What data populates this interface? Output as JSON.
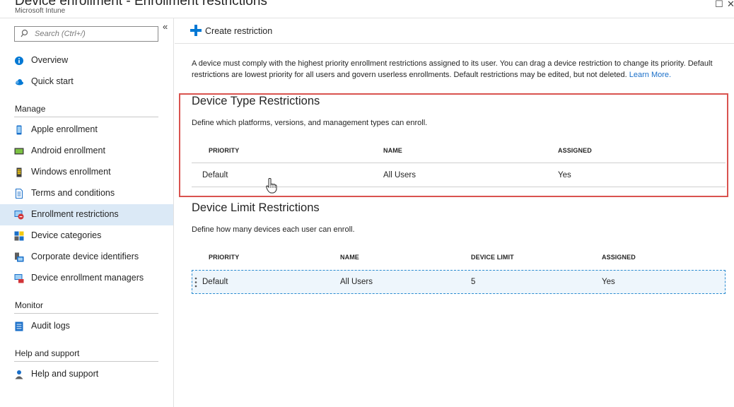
{
  "header": {
    "title": "Device enrollment - Enrollment restrictions",
    "subtitle": "Microsoft Intune"
  },
  "sidebar": {
    "search_placeholder": "Search (Ctrl+/)",
    "collapse_glyph": "«",
    "items_top": [
      {
        "label": "Overview",
        "icon": "info-icon"
      },
      {
        "label": "Quick start",
        "icon": "cloud-icon"
      }
    ],
    "manage_header": "Manage",
    "manage_items": [
      {
        "label": "Apple enrollment",
        "icon": "phone-icon"
      },
      {
        "label": "Android enrollment",
        "icon": "tablet-icon"
      },
      {
        "label": "Windows enrollment",
        "icon": "windows-phone-icon"
      },
      {
        "label": "Terms and conditions",
        "icon": "document-icon"
      },
      {
        "label": "Enrollment restrictions",
        "icon": "restriction-icon",
        "active": true
      },
      {
        "label": "Device categories",
        "icon": "categories-icon"
      },
      {
        "label": "Corporate device identifiers",
        "icon": "corporate-device-icon"
      },
      {
        "label": "Device enrollment managers",
        "icon": "managers-icon"
      }
    ],
    "monitor_header": "Monitor",
    "monitor_items": [
      {
        "label": "Audit logs",
        "icon": "log-icon"
      }
    ],
    "help_header": "Help and support",
    "help_items": [
      {
        "label": "Help and support",
        "icon": "person-help-icon"
      }
    ]
  },
  "toolbar": {
    "create_label": "Create restriction"
  },
  "description": {
    "text": "A device must comply with the highest priority enrollment restrictions assigned to its user. You can drag a device restriction to change its priority. Default restrictions are lowest priority for all users and govern userless enrollments. Default restrictions may be edited, but not deleted.",
    "link": "Learn More."
  },
  "device_type": {
    "title": "Device Type Restrictions",
    "desc": "Define which platforms, versions, and management types can enroll.",
    "headers": [
      "PRIORITY",
      "NAME",
      "ASSIGNED"
    ],
    "rows": [
      [
        "Default",
        "All Users",
        "Yes"
      ]
    ]
  },
  "device_limit": {
    "title": "Device Limit Restrictions",
    "desc": "Define how many devices each user can enroll.",
    "headers": [
      "PRIORITY",
      "NAME",
      "DEVICE LIMIT",
      "ASSIGNED"
    ],
    "rows": [
      [
        "Default",
        "All Users",
        "5",
        "Yes"
      ]
    ]
  },
  "colors": {
    "accent": "#0078d4",
    "link": "#1a6fc9",
    "highlight_border": "#d9534f",
    "active_nav": "#dbe9f6"
  }
}
